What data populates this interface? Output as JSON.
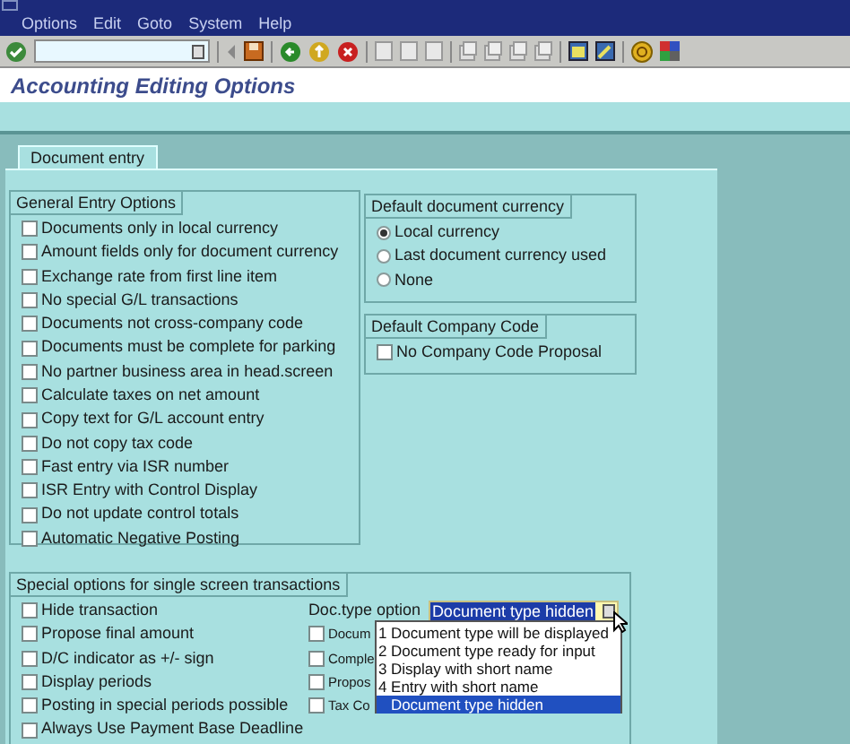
{
  "window": {
    "title": "Accounting Editing Options"
  },
  "menu": [
    "Options",
    "Edit",
    "Goto",
    "System",
    "Help"
  ],
  "tabs": [
    {
      "label": "Document entry",
      "selected": true
    }
  ],
  "general_entry_options": {
    "title": "General Entry Options",
    "items": [
      {
        "label": "Documents only in local currency",
        "checked": false
      },
      {
        "label": "Amount fields only for document currency",
        "checked": false
      },
      {
        "label": "Exchange rate from first line item",
        "checked": false
      },
      {
        "label": "No special G/L transactions",
        "checked": false
      },
      {
        "label": "Documents not cross-company code",
        "checked": false
      },
      {
        "label": "Documents must be complete for parking",
        "checked": false
      },
      {
        "label": "No partner business area in head.screen",
        "checked": false
      },
      {
        "label": "Calculate taxes on net amount",
        "checked": false
      },
      {
        "label": "Copy text for G/L account entry",
        "checked": false
      },
      {
        "label": "Do not copy tax code",
        "checked": false
      },
      {
        "label": "Fast entry via ISR number",
        "checked": false
      },
      {
        "label": "ISR Entry with Control Display",
        "checked": false
      },
      {
        "label": "Do not update control totals",
        "checked": false
      },
      {
        "label": "Automatic Negative Posting",
        "checked": false
      }
    ]
  },
  "default_document_currency": {
    "title": "Default document currency",
    "options": [
      {
        "label": "Local currency",
        "selected": true
      },
      {
        "label": "Last document currency used",
        "selected": false
      },
      {
        "label": "None",
        "selected": false
      }
    ]
  },
  "default_company_code": {
    "title": "Default Company Code",
    "items": [
      {
        "label": "No Company Code Proposal",
        "checked": false
      }
    ]
  },
  "special_options": {
    "title": "Special options for single screen transactions",
    "items": [
      {
        "label": "Hide transaction",
        "checked": false
      },
      {
        "label": "Propose final amount",
        "checked": false
      },
      {
        "label": "D/C indicator as +/- sign",
        "checked": false
      },
      {
        "label": "Display periods",
        "checked": false
      },
      {
        "label": "Posting in special periods possible",
        "checked": false
      },
      {
        "label": "Always Use Payment Base Deadline",
        "checked": false
      }
    ],
    "doc_type_option": {
      "label": "Doc.type option",
      "value": "Document type hidden",
      "items": [
        {
          "label": "Docum",
          "checked": false
        },
        {
          "label": "Comple",
          "checked": false
        },
        {
          "label": "Propos",
          "checked": false
        },
        {
          "label": "Tax Co",
          "checked": false
        }
      ],
      "dropdown": [
        {
          "label": "1 Document type will be displayed",
          "selected": false
        },
        {
          "label": "2 Document type ready for input",
          "selected": false
        },
        {
          "label": "3 Display with short name",
          "selected": false
        },
        {
          "label": "4 Entry with short name",
          "selected": false
        },
        {
          "label": "Document type hidden",
          "selected": true
        }
      ]
    }
  }
}
